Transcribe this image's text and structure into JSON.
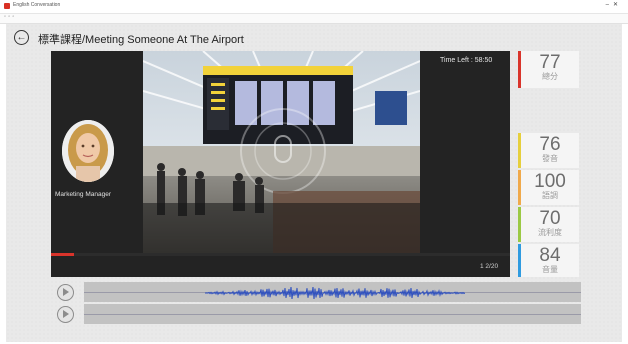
{
  "window": {
    "title": "English Conversation"
  },
  "header": {
    "page_title": "標準課程/Meeting Someone At The Airport"
  },
  "video": {
    "time_left": "Time Left : 58:50",
    "speaker_role": "Marketing Manager",
    "progress_fraction": 0.05,
    "counter": "1 2/20"
  },
  "scores": {
    "overall": {
      "value": "77",
      "label": "總分",
      "color": "#d9342b"
    },
    "items": [
      {
        "value": "76",
        "label": "發音",
        "color": "#e6cf3c"
      },
      {
        "value": "100",
        "label": "語調",
        "color": "#f0a94a"
      },
      {
        "value": "70",
        "label": "流利度",
        "color": "#9bc944"
      },
      {
        "value": "84",
        "label": "音量",
        "color": "#2f9be0"
      }
    ]
  },
  "icons": [
    "back-arrow-icon",
    "play-icon"
  ]
}
